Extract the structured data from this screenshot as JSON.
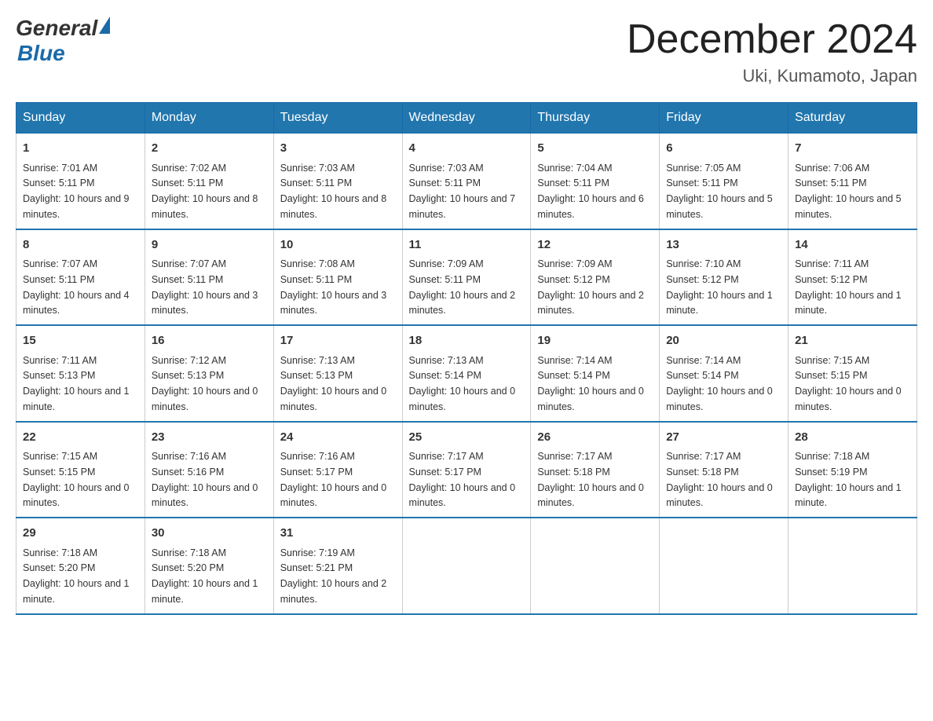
{
  "header": {
    "logo_general": "General",
    "logo_blue": "Blue",
    "month_year": "December 2024",
    "location": "Uki, Kumamoto, Japan"
  },
  "days_of_week": [
    "Sunday",
    "Monday",
    "Tuesday",
    "Wednesday",
    "Thursday",
    "Friday",
    "Saturday"
  ],
  "weeks": [
    [
      {
        "day": "1",
        "sunrise": "7:01 AM",
        "sunset": "5:11 PM",
        "daylight": "10 hours and 9 minutes."
      },
      {
        "day": "2",
        "sunrise": "7:02 AM",
        "sunset": "5:11 PM",
        "daylight": "10 hours and 8 minutes."
      },
      {
        "day": "3",
        "sunrise": "7:03 AM",
        "sunset": "5:11 PM",
        "daylight": "10 hours and 8 minutes."
      },
      {
        "day": "4",
        "sunrise": "7:03 AM",
        "sunset": "5:11 PM",
        "daylight": "10 hours and 7 minutes."
      },
      {
        "day": "5",
        "sunrise": "7:04 AM",
        "sunset": "5:11 PM",
        "daylight": "10 hours and 6 minutes."
      },
      {
        "day": "6",
        "sunrise": "7:05 AM",
        "sunset": "5:11 PM",
        "daylight": "10 hours and 5 minutes."
      },
      {
        "day": "7",
        "sunrise": "7:06 AM",
        "sunset": "5:11 PM",
        "daylight": "10 hours and 5 minutes."
      }
    ],
    [
      {
        "day": "8",
        "sunrise": "7:07 AM",
        "sunset": "5:11 PM",
        "daylight": "10 hours and 4 minutes."
      },
      {
        "day": "9",
        "sunrise": "7:07 AM",
        "sunset": "5:11 PM",
        "daylight": "10 hours and 3 minutes."
      },
      {
        "day": "10",
        "sunrise": "7:08 AM",
        "sunset": "5:11 PM",
        "daylight": "10 hours and 3 minutes."
      },
      {
        "day": "11",
        "sunrise": "7:09 AM",
        "sunset": "5:11 PM",
        "daylight": "10 hours and 2 minutes."
      },
      {
        "day": "12",
        "sunrise": "7:09 AM",
        "sunset": "5:12 PM",
        "daylight": "10 hours and 2 minutes."
      },
      {
        "day": "13",
        "sunrise": "7:10 AM",
        "sunset": "5:12 PM",
        "daylight": "10 hours and 1 minute."
      },
      {
        "day": "14",
        "sunrise": "7:11 AM",
        "sunset": "5:12 PM",
        "daylight": "10 hours and 1 minute."
      }
    ],
    [
      {
        "day": "15",
        "sunrise": "7:11 AM",
        "sunset": "5:13 PM",
        "daylight": "10 hours and 1 minute."
      },
      {
        "day": "16",
        "sunrise": "7:12 AM",
        "sunset": "5:13 PM",
        "daylight": "10 hours and 0 minutes."
      },
      {
        "day": "17",
        "sunrise": "7:13 AM",
        "sunset": "5:13 PM",
        "daylight": "10 hours and 0 minutes."
      },
      {
        "day": "18",
        "sunrise": "7:13 AM",
        "sunset": "5:14 PM",
        "daylight": "10 hours and 0 minutes."
      },
      {
        "day": "19",
        "sunrise": "7:14 AM",
        "sunset": "5:14 PM",
        "daylight": "10 hours and 0 minutes."
      },
      {
        "day": "20",
        "sunrise": "7:14 AM",
        "sunset": "5:14 PM",
        "daylight": "10 hours and 0 minutes."
      },
      {
        "day": "21",
        "sunrise": "7:15 AM",
        "sunset": "5:15 PM",
        "daylight": "10 hours and 0 minutes."
      }
    ],
    [
      {
        "day": "22",
        "sunrise": "7:15 AM",
        "sunset": "5:15 PM",
        "daylight": "10 hours and 0 minutes."
      },
      {
        "day": "23",
        "sunrise": "7:16 AM",
        "sunset": "5:16 PM",
        "daylight": "10 hours and 0 minutes."
      },
      {
        "day": "24",
        "sunrise": "7:16 AM",
        "sunset": "5:17 PM",
        "daylight": "10 hours and 0 minutes."
      },
      {
        "day": "25",
        "sunrise": "7:17 AM",
        "sunset": "5:17 PM",
        "daylight": "10 hours and 0 minutes."
      },
      {
        "day": "26",
        "sunrise": "7:17 AM",
        "sunset": "5:18 PM",
        "daylight": "10 hours and 0 minutes."
      },
      {
        "day": "27",
        "sunrise": "7:17 AM",
        "sunset": "5:18 PM",
        "daylight": "10 hours and 0 minutes."
      },
      {
        "day": "28",
        "sunrise": "7:18 AM",
        "sunset": "5:19 PM",
        "daylight": "10 hours and 1 minute."
      }
    ],
    [
      {
        "day": "29",
        "sunrise": "7:18 AM",
        "sunset": "5:20 PM",
        "daylight": "10 hours and 1 minute."
      },
      {
        "day": "30",
        "sunrise": "7:18 AM",
        "sunset": "5:20 PM",
        "daylight": "10 hours and 1 minute."
      },
      {
        "day": "31",
        "sunrise": "7:19 AM",
        "sunset": "5:21 PM",
        "daylight": "10 hours and 2 minutes."
      },
      {
        "day": "",
        "sunrise": "",
        "sunset": "",
        "daylight": ""
      },
      {
        "day": "",
        "sunrise": "",
        "sunset": "",
        "daylight": ""
      },
      {
        "day": "",
        "sunrise": "",
        "sunset": "",
        "daylight": ""
      },
      {
        "day": "",
        "sunrise": "",
        "sunset": "",
        "daylight": ""
      }
    ]
  ],
  "labels": {
    "sunrise_prefix": "Sunrise: ",
    "sunset_prefix": "Sunset: ",
    "daylight_prefix": "Daylight: "
  }
}
